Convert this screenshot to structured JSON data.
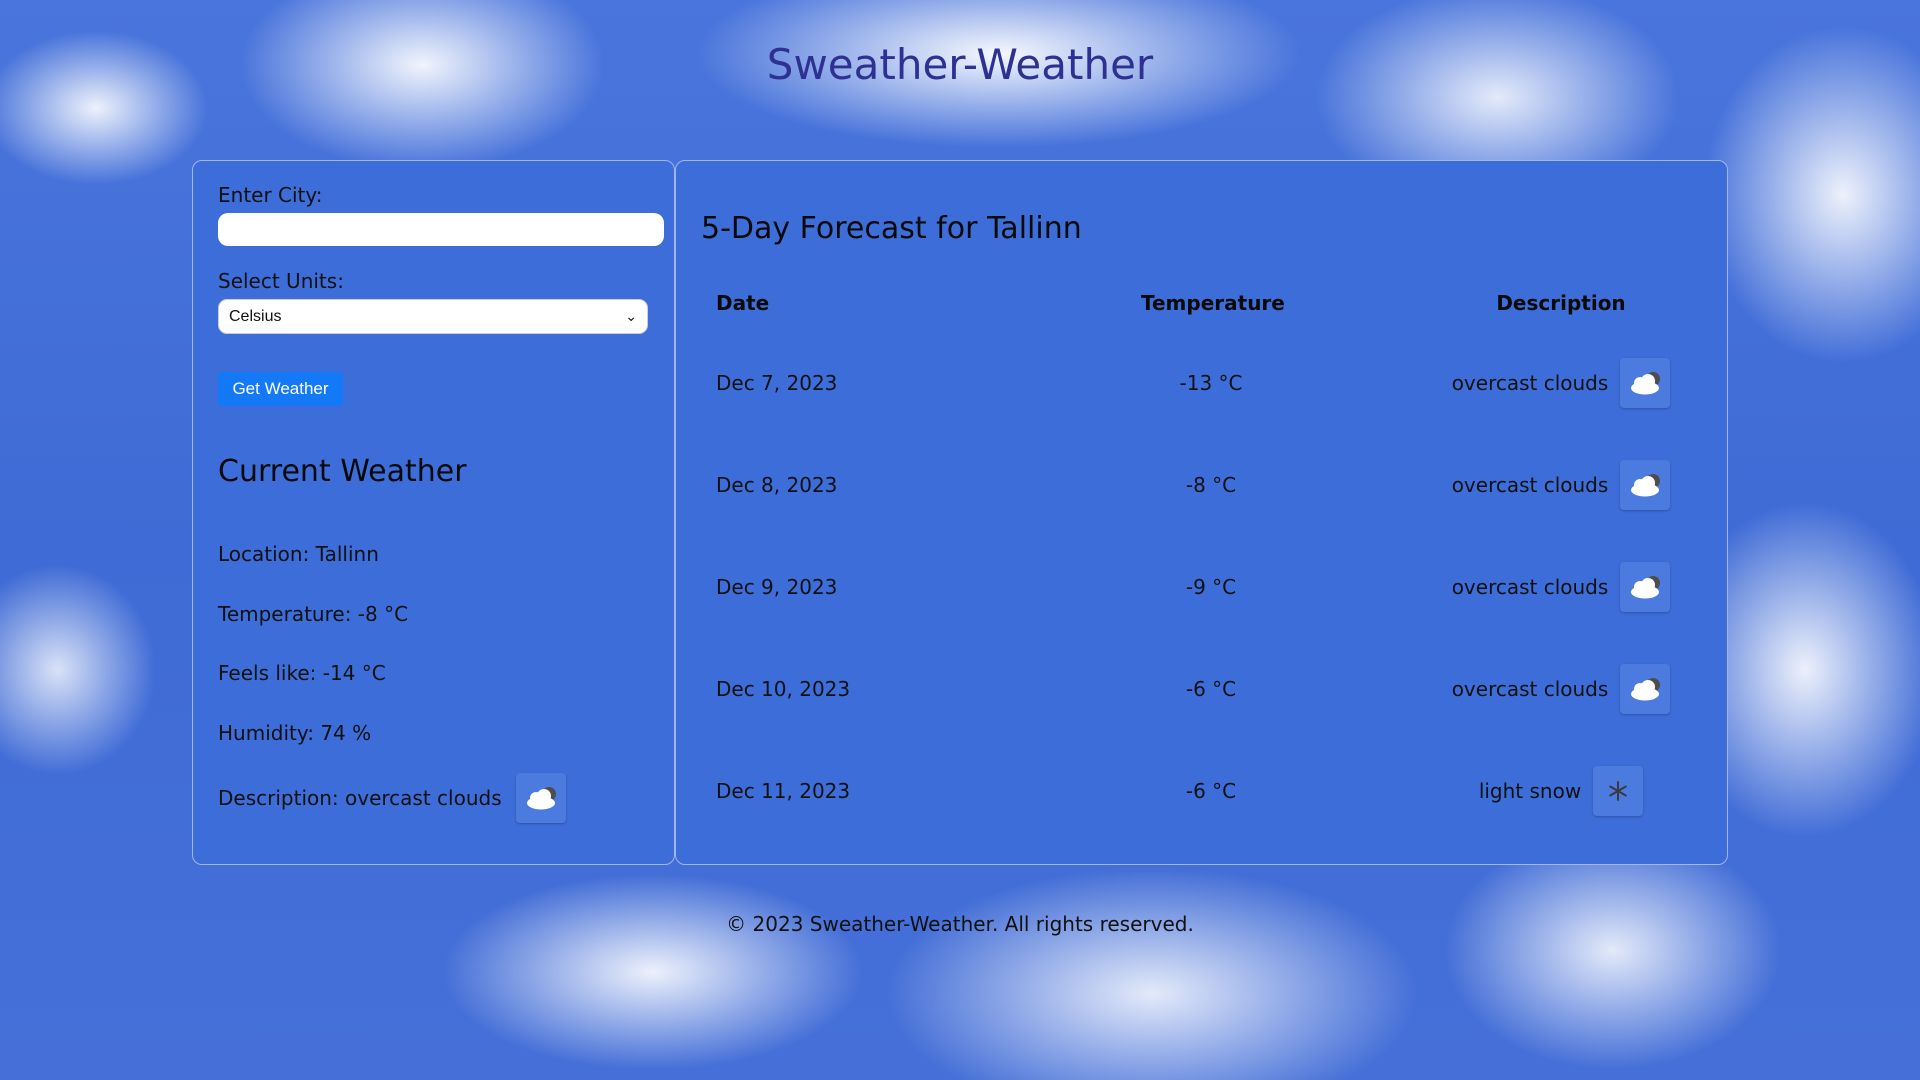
{
  "app": {
    "title": "Sweather-Weather"
  },
  "search": {
    "city_label": "Enter City:",
    "city_value": "",
    "units_label": "Select Units:",
    "units_selected": "Celsius",
    "button_label": "Get Weather"
  },
  "current": {
    "title": "Current Weather",
    "location": "Location: Tallinn",
    "temperature": "Temperature: -8 °C",
    "feels_like": "Feels like: -14 °C",
    "humidity": "Humidity: 74 %",
    "description": "Description: overcast clouds",
    "icon": "cloud-icon"
  },
  "forecast": {
    "title": "5-Day Forecast for Tallinn",
    "headers": {
      "date": "Date",
      "temperature": "Temperature",
      "description": "Description"
    },
    "rows": [
      {
        "date": "Dec 7, 2023",
        "temp": "-13 °C",
        "desc": "overcast clouds",
        "icon": "cloud-icon"
      },
      {
        "date": "Dec 8, 2023",
        "temp": "-8 °C",
        "desc": "overcast clouds",
        "icon": "cloud-icon"
      },
      {
        "date": "Dec 9, 2023",
        "temp": "-9 °C",
        "desc": "overcast clouds",
        "icon": "cloud-icon"
      },
      {
        "date": "Dec 10, 2023",
        "temp": "-6 °C",
        "desc": "overcast clouds",
        "icon": "cloud-icon"
      },
      {
        "date": "Dec 11, 2023",
        "temp": "-6 °C",
        "desc": "light snow",
        "icon": "snowflake-icon"
      }
    ]
  },
  "footer": {
    "text": "© 2023 Sweather-Weather. All rights reserved."
  },
  "colors": {
    "panel": "#3d6dd9",
    "title": "#2e3192",
    "button": "#1479f7"
  }
}
